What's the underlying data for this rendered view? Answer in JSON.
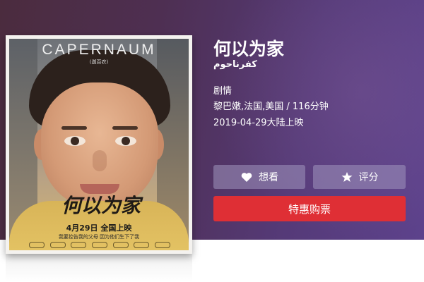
{
  "movie": {
    "title": "何以为家",
    "original_title": "كفرناحوم",
    "genre": "剧情",
    "region_duration": "黎巴嫩,法国,美国 / 116分钟",
    "release": "2019-04-29大陆上映"
  },
  "poster": {
    "title_en": "CAPERNAUM",
    "subtitle": "(迦百农)",
    "calligraphy": "何以为家",
    "date_line": "4月29日 全国上映",
    "tagline": "我要控告我的父母 因为他们生下了我"
  },
  "actions": {
    "want_label": "想看",
    "rate_label": "评分",
    "buy_label": "特惠购票",
    "want_icon": "heart-icon",
    "rate_icon": "star-icon"
  },
  "colors": {
    "buy_button": "#df2f35",
    "hero_gradient_start": "#4b2c3e",
    "hero_gradient_end": "#5d428c"
  }
}
